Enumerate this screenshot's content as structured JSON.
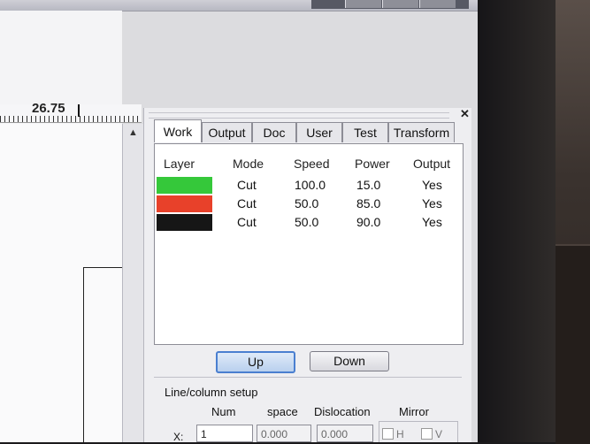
{
  "ruler": {
    "value": "26.75"
  },
  "panel": {
    "tabs": [
      {
        "label": "Work",
        "active": true
      },
      {
        "label": "Output",
        "active": false
      },
      {
        "label": "Doc",
        "active": false
      },
      {
        "label": "User",
        "active": false
      },
      {
        "label": "Test",
        "active": false
      },
      {
        "label": "Transform",
        "active": false
      }
    ],
    "layer_table": {
      "headers": [
        "Layer",
        "Mode",
        "Speed",
        "Power",
        "Output"
      ],
      "rows": [
        {
          "color": "#35c83a",
          "mode": "Cut",
          "speed": "100.0",
          "power": "15.0",
          "output": "Yes"
        },
        {
          "color": "#e8412a",
          "mode": "Cut",
          "speed": "50.0",
          "power": "85.0",
          "output": "Yes"
        },
        {
          "color": "#161616",
          "mode": "Cut",
          "speed": "50.0",
          "power": "90.0",
          "output": "Yes"
        }
      ]
    },
    "buttons": {
      "up": "Up",
      "down": "Down"
    },
    "line_column": {
      "title": "Line/column setup",
      "col_num": "Num",
      "col_space": "space",
      "col_dislocation": "Dislocation",
      "col_mirror": "Mirror",
      "x_label": "X:",
      "x_num": "1",
      "x_space": "0.000",
      "x_dislocation": "0.000",
      "mirror_h": "H",
      "mirror_v": "V"
    }
  }
}
